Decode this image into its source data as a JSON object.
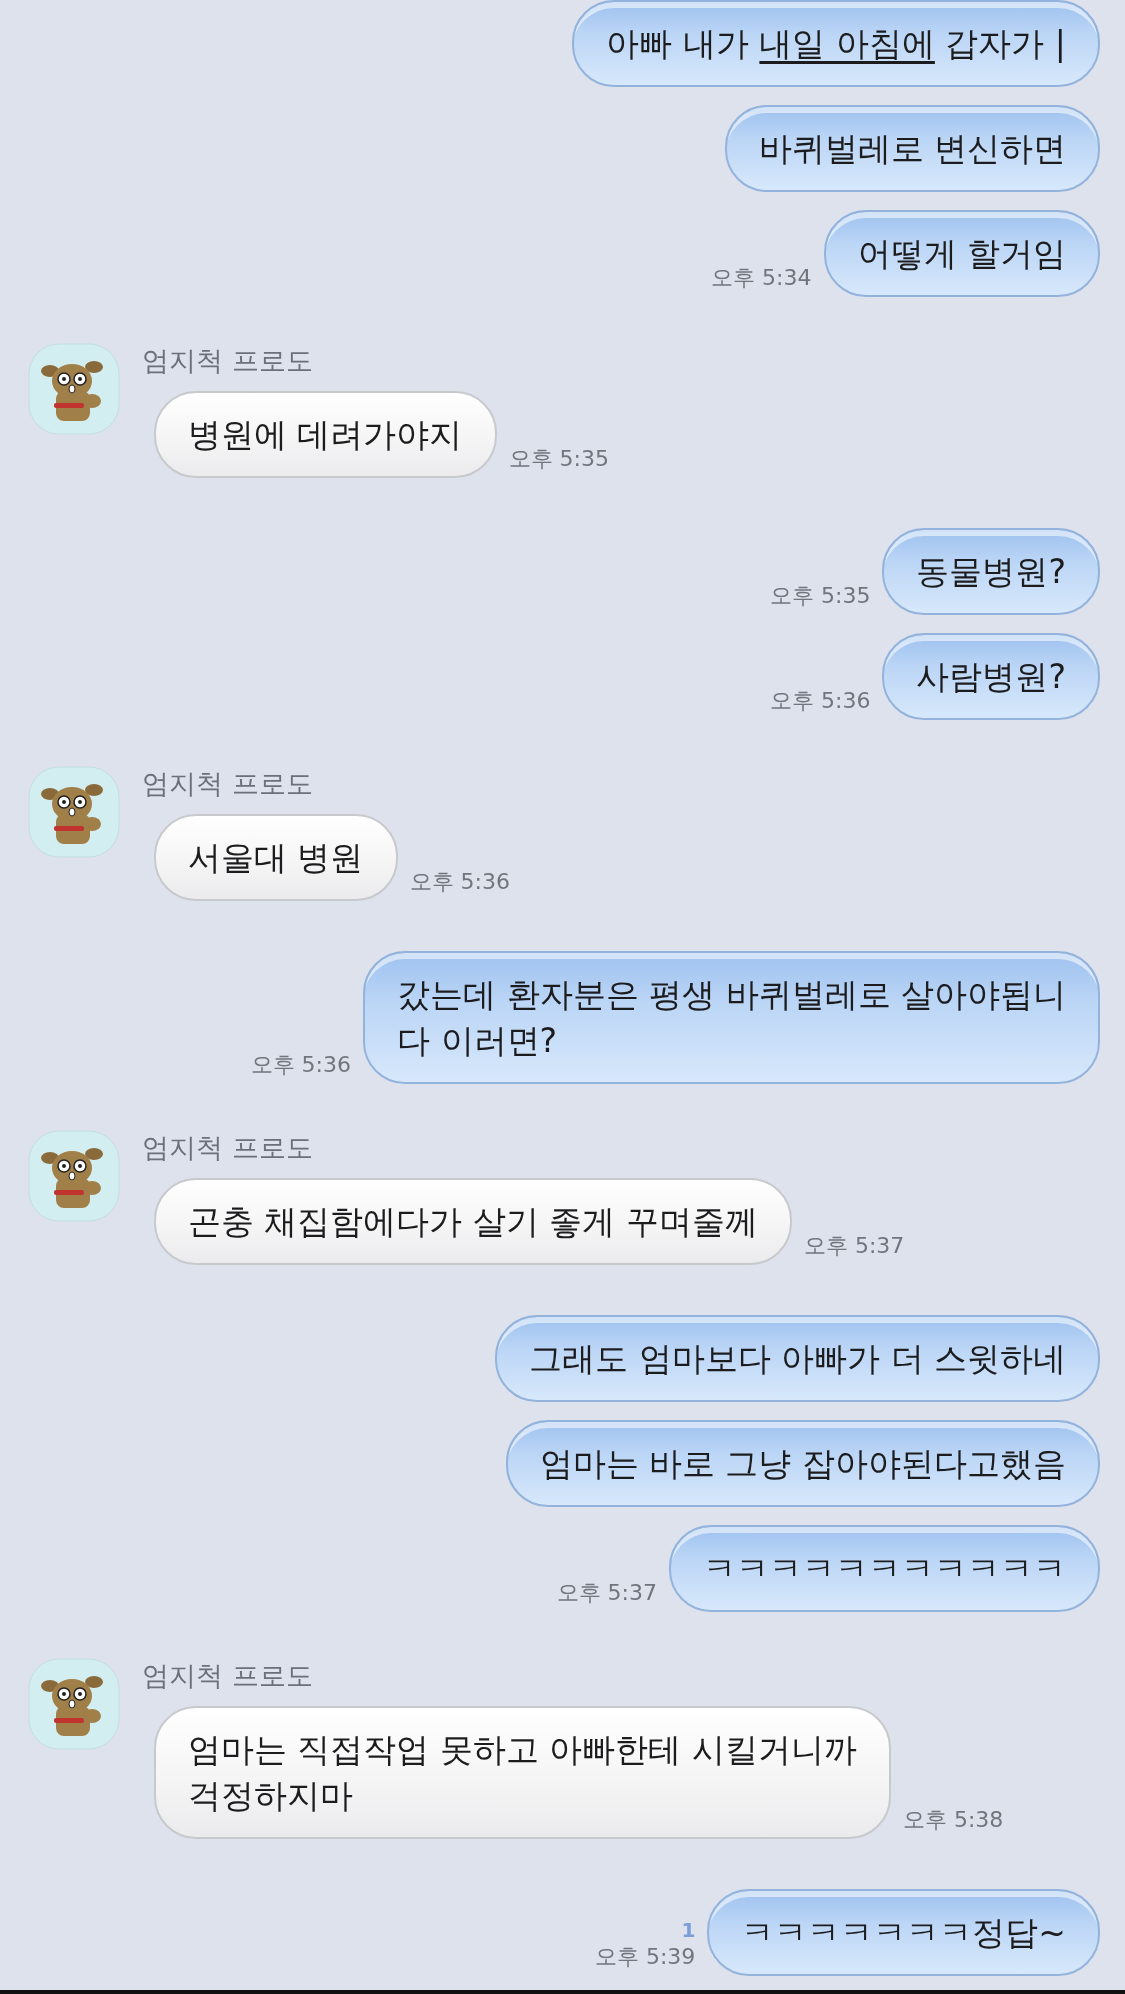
{
  "messages": [
    {
      "kind": "outgoing",
      "segments": [
        {
          "text": "아빠 내가 ",
          "underline": false
        },
        {
          "text": "내일 아침에",
          "underline": true
        },
        {
          "text": " 갑자가 |",
          "underline": false
        }
      ]
    },
    {
      "kind": "outgoing",
      "segments": [
        {
          "text": "바퀴벌레로 변신하면"
        }
      ]
    },
    {
      "kind": "outgoing",
      "time": "오후 5:34",
      "segments": [
        {
          "text": "어떻게 할거임"
        }
      ]
    },
    {
      "kind": "incoming",
      "name": "엄지척 프로도",
      "time": "오후 5:35",
      "segments": [
        {
          "text": "병원에 데려가야지"
        }
      ]
    },
    {
      "kind": "outgoing",
      "time": "오후 5:35",
      "segments": [
        {
          "text": "동물병원?"
        }
      ]
    },
    {
      "kind": "outgoing",
      "time": "오후 5:36",
      "segments": [
        {
          "text": "사람병원?"
        }
      ]
    },
    {
      "kind": "incoming",
      "name": "엄지척 프로도",
      "time": "오후 5:36",
      "segments": [
        {
          "text": "서울대 병원"
        }
      ]
    },
    {
      "kind": "outgoing",
      "time": "오후 5:36",
      "segments": [
        {
          "text": "갔는데 환자분은 평생 바퀴벌레로 살아야됩니\n다 이러면?"
        }
      ]
    },
    {
      "kind": "incoming",
      "name": "엄지척 프로도",
      "time": "오후 5:37",
      "segments": [
        {
          "text": "곤충 채집함에다가 살기 좋게 꾸며줄께"
        }
      ]
    },
    {
      "kind": "outgoing",
      "segments": [
        {
          "text": "그래도 엄마보다 아빠가 더 스윗하네"
        }
      ]
    },
    {
      "kind": "outgoing",
      "segments": [
        {
          "text": "엄마는 바로 그냥 잡아야된다고했음"
        }
      ]
    },
    {
      "kind": "outgoing",
      "time": "오후 5:37",
      "segments": [
        {
          "text": "ㅋㅋㅋㅋㅋㅋㅋㅋㅋㅋㅋ"
        }
      ]
    },
    {
      "kind": "incoming",
      "name": "엄지척 프로도",
      "time": "오후 5:38",
      "segments": [
        {
          "text": "엄마는 직접작업 못하고 아빠한테 시킬거니까\n걱정하지마"
        }
      ]
    },
    {
      "kind": "outgoing",
      "unread": "1",
      "time": "오후 5:39",
      "segments": [
        {
          "text": "ㅋㅋㅋㅋㅋㅋㅋ정답~"
        }
      ]
    }
  ]
}
